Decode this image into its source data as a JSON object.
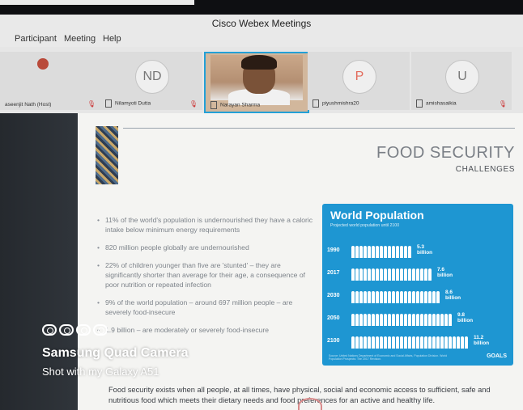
{
  "window": {
    "title": "Cisco Webex Meetings"
  },
  "menu": {
    "items": [
      "Participant",
      "Meeting",
      "Help"
    ]
  },
  "participants": [
    {
      "label": "",
      "name": "aseenjit Nath (Host)",
      "type": "logo",
      "muted": true
    },
    {
      "label": "ND",
      "name": "Nilamyoti Dutta",
      "type": "initials",
      "muted": true
    },
    {
      "label": "",
      "name": "Narayan Sharma",
      "type": "video",
      "active": true,
      "muted": false
    },
    {
      "label": "P",
      "name": "piyushmishra20",
      "type": "initials",
      "muted": false
    },
    {
      "label": "U",
      "name": "amishasaikia",
      "type": "initials",
      "muted": true
    }
  ],
  "slide": {
    "title": "FOOD SECURITY",
    "subtitle": "CHALLENGES",
    "bullets": [
      "11% of the world's population is undernourished they have a caloric intake below minimum energy requirements",
      "820 million people globally are undernourished",
      "22% of children younger than five are 'stunted' – they are significantly shorter than average for their age, a consequence of poor nutrition or repeated infection",
      "9% of the world population – around 697 million people – are severely food-insecure",
      "1.9 billion – are moderately or severely food-insecure"
    ],
    "footer": "Food security exists when all people, at all times, have physical, social and economic access to sufficient, safe and nutritious food which meets their dietary needs and food preferences for an active and healthy life.",
    "infographic": {
      "title": "World Population",
      "subtitle": "Projected world population until 2100",
      "rows": [
        {
          "year": "1990",
          "value": "5.3",
          "unit": "billion",
          "people": 15
        },
        {
          "year": "2017",
          "value": "7.6",
          "unit": "billion",
          "people": 20
        },
        {
          "year": "2030",
          "value": "8.6",
          "unit": "billion",
          "people": 22
        },
        {
          "year": "2050",
          "value": "9.8",
          "unit": "billion",
          "people": 25
        },
        {
          "year": "2100",
          "value": "11.2",
          "unit": "billion",
          "people": 29
        }
      ],
      "footnote": "Source: United Nations Department of Economic and Social Affairs, Population Division. World Population Prospects: The 2017 Revision.",
      "brand": "GOALS"
    }
  },
  "watermark": {
    "brand": "Samsung Quad Camera",
    "line": "Shot with my Galaxy A51"
  }
}
